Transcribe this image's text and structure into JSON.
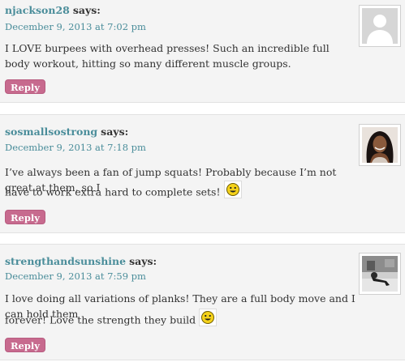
{
  "comments": [
    {
      "author": "njackson28",
      "says": "says:",
      "date": "December 9, 2013 at 7:02 pm",
      "text": "I LOVE burpees with overhead presses! Such an incredible full body workout, hitting so many different muscle groups.",
      "reply_label": "Reply",
      "avatar_icon": "default-avatar-icon"
    },
    {
      "author": "sosmallsostrong",
      "says": "says:",
      "date": "December 9, 2013 at 7:18 pm",
      "text_line1": "I’ve always been a fan of jump squats! Probably because I’m not great at them, so I",
      "text_line2": "have to work extra hard to complete sets!",
      "reply_label": "Reply",
      "avatar_icon": "user-photo-avatar",
      "emoji": "smiley-icon"
    },
    {
      "author": "strengthandsunshine",
      "says": "says:",
      "date": "December 9, 2013 at 7:59 pm",
      "text_line1": "I love doing all variations of planks! They are a full body move and I can hold them",
      "text_line2": "forever! Love the strength they build",
      "reply_label": "Reply",
      "avatar_icon": "user-photo-avatar",
      "emoji": "smiley-icon"
    }
  ],
  "colors": {
    "author": "#4a8d9a",
    "reply_bg": "#c76a8e",
    "comment_bg": "#f4f4f4"
  }
}
